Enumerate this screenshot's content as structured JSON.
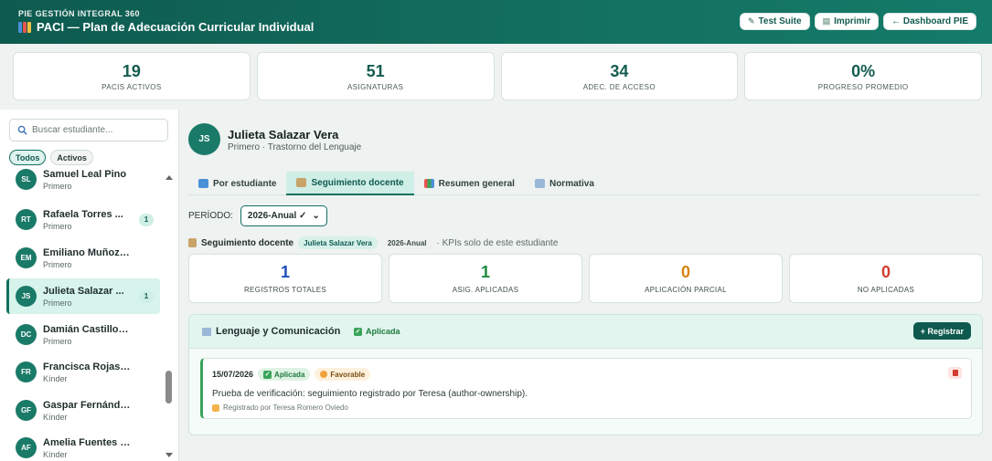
{
  "header": {
    "eyebrow": "PIE GESTIÓN INTEGRAL 360",
    "title": "PACI — Plan de Adecuación Curricular Individual",
    "buttons": {
      "test_suite": "Test Suite",
      "print": "Imprimir",
      "dashboard": "← Dashboard PIE"
    }
  },
  "summary_kpis": [
    {
      "value": "19",
      "label": "PACIS ACTIVOS"
    },
    {
      "value": "51",
      "label": "ASIGNATURAS"
    },
    {
      "value": "34",
      "label": "ADEC. DE ACCESO"
    },
    {
      "value": "0%",
      "label": "PROGRESO PROMEDIO"
    }
  ],
  "sidebar": {
    "search_placeholder": "Buscar estudiante...",
    "filters": [
      "Todos",
      "Activos"
    ],
    "students": [
      {
        "initials": "SL",
        "name": "Samuel Leal Pino",
        "level": "Primero",
        "count": ""
      },
      {
        "initials": "RT",
        "name": "Rafaela Torres ...",
        "level": "Primero",
        "count": "1"
      },
      {
        "initials": "EM",
        "name": "Emiliano Muñoz Guti...",
        "level": "Primero",
        "count": ""
      },
      {
        "initials": "JS",
        "name": "Julieta Salazar ...",
        "level": "Primero",
        "count": "1"
      },
      {
        "initials": "DC",
        "name": "Damián Castillo Araya",
        "level": "Primero",
        "count": ""
      },
      {
        "initials": "FR",
        "name": "Francisca Rojas Díaz",
        "level": "Kínder",
        "count": ""
      },
      {
        "initials": "GF",
        "name": "Gaspar Fernández La...",
        "level": "Kínder",
        "count": ""
      },
      {
        "initials": "AF",
        "name": "Amelia Fuentes Cont...",
        "level": "Kínder",
        "count": ""
      }
    ]
  },
  "student": {
    "initials": "JS",
    "name": "Julieta Salazar Vera",
    "subtitle": "Primero · Trastorno del Lenguaje"
  },
  "tabs": [
    "Por estudiante",
    "Seguimiento docente",
    "Resumen general",
    "Normativa"
  ],
  "period": {
    "label": "PERÍODO:",
    "value": "2026-Anual ✓"
  },
  "context": {
    "title": "Seguimiento docente",
    "student_pill": "Julieta Salazar Vera",
    "period_pill": "2026-Anual",
    "note": "· KPIs solo de este estudiante"
  },
  "kpis": [
    {
      "value": "1",
      "label": "REGISTROS TOTALES",
      "color": "#1f4fb8"
    },
    {
      "value": "1",
      "label": "ASIG. APLICADAS",
      "color": "#1e8a3d"
    },
    {
      "value": "0",
      "label": "APLICACIÓN PARCIAL",
      "color": "#d9820f"
    },
    {
      "value": "0",
      "label": "NO APLICADAS",
      "color": "#d23b2f"
    }
  ],
  "subject": {
    "title": "Lenguaje y Comunicación",
    "status": "Aplicada",
    "register_button": "+ Registrar",
    "entry": {
      "date": "15/07/2026",
      "status": "Aplicada",
      "rating": "Favorable",
      "description": "Prueba de verificación: seguimiento registrado por Teresa (author-ownership).",
      "author": "Registrado por Teresa Romero Oviedo"
    }
  }
}
